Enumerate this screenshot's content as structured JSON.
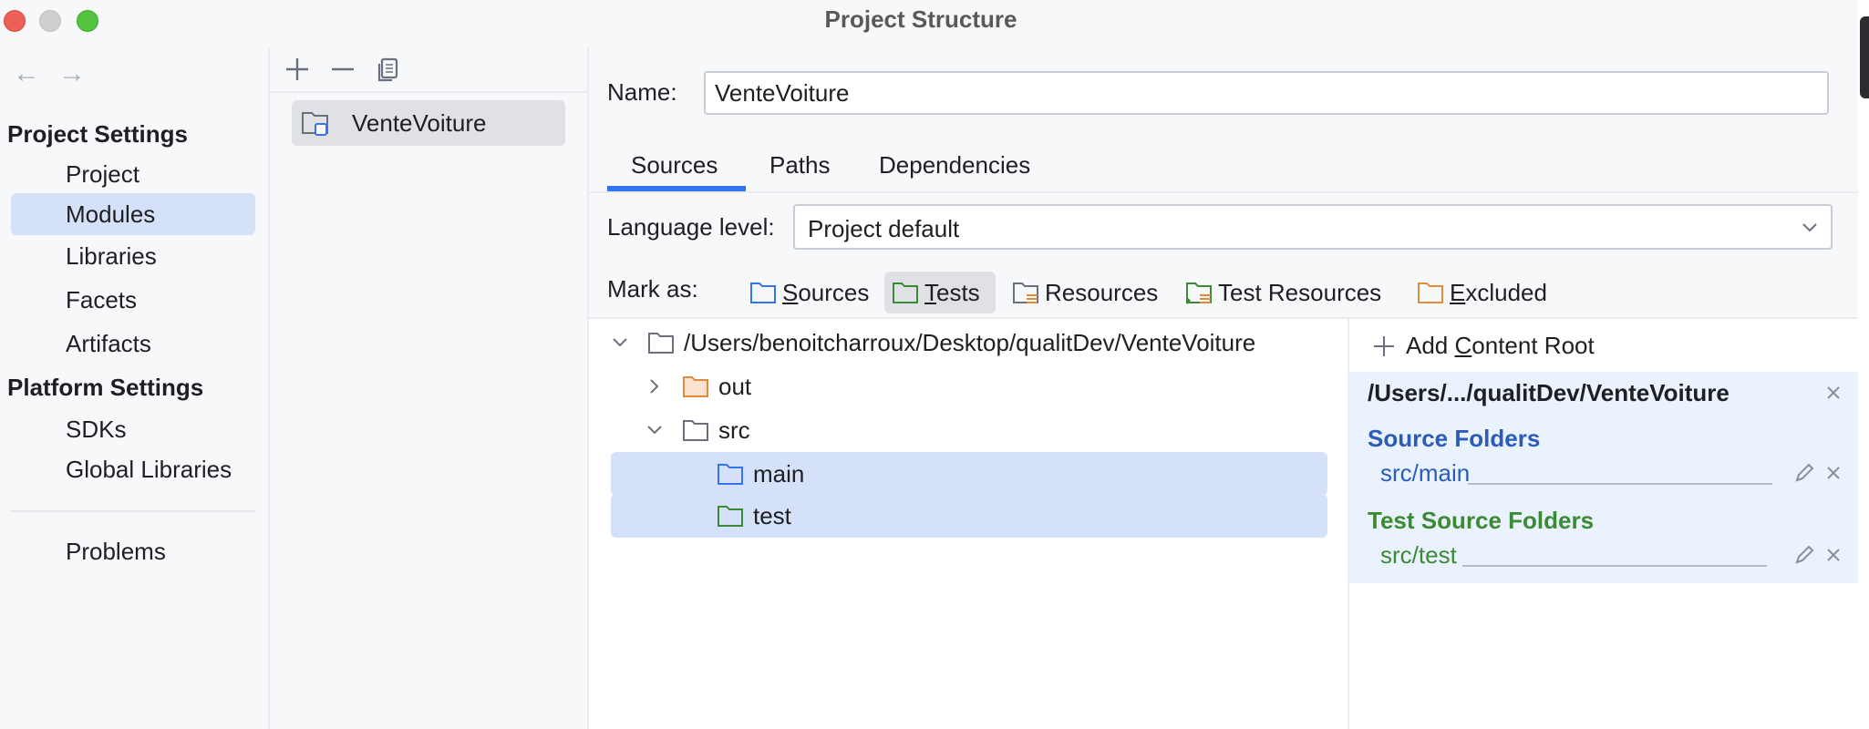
{
  "window": {
    "title": "Project Structure"
  },
  "nav": {
    "sections": [
      {
        "label": "Project Settings",
        "items": [
          "Project",
          "Modules",
          "Libraries",
          "Facets",
          "Artifacts"
        ]
      },
      {
        "label": "Platform Settings",
        "items": [
          "SDKs",
          "Global Libraries"
        ]
      }
    ],
    "problems": "Problems",
    "selected": "Modules"
  },
  "modules": {
    "items": [
      "VenteVoiture"
    ]
  },
  "module": {
    "name_label": "Name:",
    "name_value": "VenteVoiture",
    "tabs": [
      "Sources",
      "Paths",
      "Dependencies"
    ],
    "active_tab": "Sources",
    "language_label": "Language level:",
    "language_value": "Project default",
    "mark_as_label": "Mark as:",
    "mark_buttons": [
      {
        "mnemonic": "S",
        "rest": "ources",
        "color": "#3574f0"
      },
      {
        "mnemonic": "T",
        "rest": "ests",
        "color": "#3c8a35"
      },
      {
        "mnemonic": "",
        "rest": "Resources",
        "color": "#6c707e"
      },
      {
        "mnemonic": "",
        "rest": "Test Resources",
        "color": "#3c8a35"
      },
      {
        "mnemonic": "E",
        "rest": "xcluded",
        "color": "#e08a3c"
      }
    ]
  },
  "tree": {
    "root": "/Users/benoitcharroux/Desktop/qualitDev/VenteVoiture",
    "out": "out",
    "src": "src",
    "main": "main",
    "test": "test"
  },
  "content_root": {
    "add_prefix": "Add ",
    "add_mnemonic": "C",
    "add_rest": "ontent Root",
    "path": "/Users/.../qualitDev/VenteVoiture",
    "source_title": "Source Folders",
    "source_path": "src/main",
    "test_title": "Test Source Folders",
    "test_path": "src/test"
  },
  "colors": {
    "accent": "#3574f0",
    "selection": "#d5e1f9",
    "source_title": "#2a5cb8",
    "test_title": "#3c8a35",
    "excluded": "#e08a3c"
  }
}
